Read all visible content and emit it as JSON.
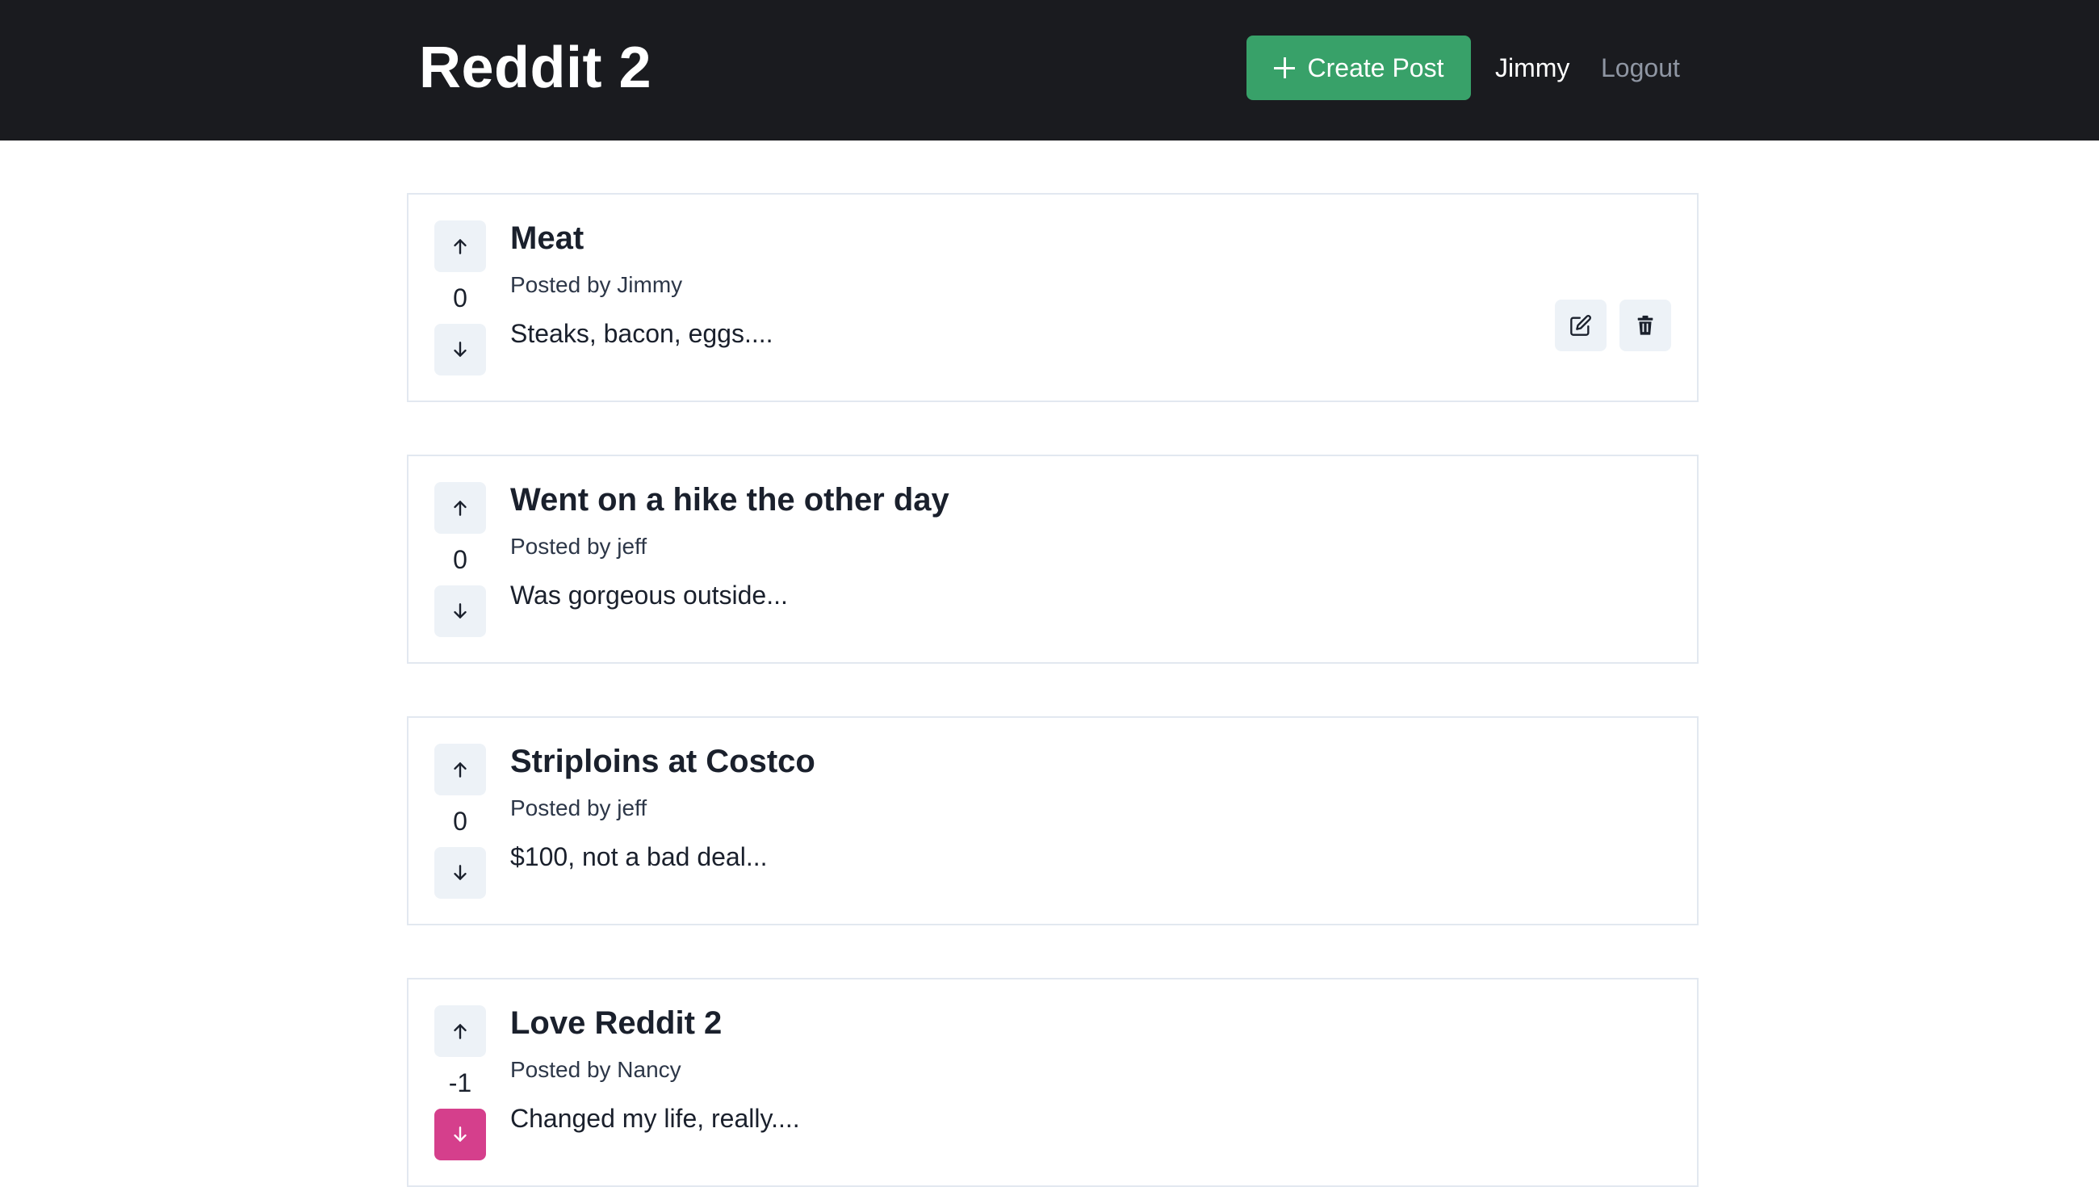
{
  "header": {
    "brand": "Reddit 2",
    "create_post_label": "Create Post",
    "username": "Jimmy",
    "logout_label": "Logout"
  },
  "posts": [
    {
      "title": "Meat",
      "author_line": "Posted by Jimmy",
      "snippet": "Steaks, bacon, eggs....",
      "score": "0",
      "downvoted": false,
      "owned": true
    },
    {
      "title": "Went on a hike the other day",
      "author_line": "Posted by jeff",
      "snippet": "Was gorgeous outside...",
      "score": "0",
      "downvoted": false,
      "owned": false
    },
    {
      "title": "Striploins at Costco",
      "author_line": "Posted by jeff",
      "snippet": "$100, not a bad deal...",
      "score": "0",
      "downvoted": false,
      "owned": false
    },
    {
      "title": "Love Reddit 2",
      "author_line": "Posted by Nancy",
      "snippet": "Changed my life, really....",
      "score": "-1",
      "downvoted": true,
      "owned": false
    }
  ],
  "colors": {
    "header_bg": "#1a1b1f",
    "create_button": "#38a169",
    "logout_text": "#8f96a3",
    "downvote_active": "#d53f8c",
    "button_bg": "#edf2f7"
  },
  "icons": {
    "upvote": "arrow-up-icon",
    "downvote": "arrow-down-icon",
    "edit": "edit-icon",
    "delete": "trash-icon",
    "create": "plus-icon"
  }
}
